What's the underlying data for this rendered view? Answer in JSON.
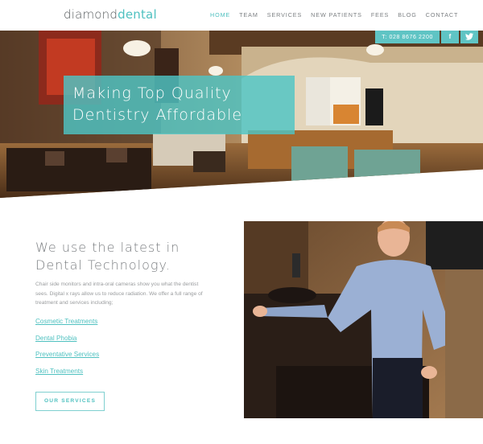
{
  "header": {
    "logo": {
      "part1": "diamond",
      "part2": "dental"
    },
    "nav": [
      {
        "label": "HOME",
        "active": true
      },
      {
        "label": "TEAM",
        "active": false
      },
      {
        "label": "SERVICES",
        "active": false
      },
      {
        "label": "NEW PATIENTS",
        "active": false
      },
      {
        "label": "FEES",
        "active": false
      },
      {
        "label": "BLOG",
        "active": false
      },
      {
        "label": "CONTACT",
        "active": false
      }
    ]
  },
  "hero": {
    "phone": "T: 028 8676 2200",
    "facebook_icon": "f",
    "twitter_icon": "t",
    "title_line1": "Making Top Quality",
    "title_line2": "Dentistry Affordable"
  },
  "main": {
    "headline_line1": "We use the latest in",
    "headline_line2": "Dental Technology.",
    "paragraph": "Chair side monitors and intra-oral cameras show you what the dentist sees. Digital x rays allow us to reduce radiation. We offer a full range of treatment and services including;",
    "links": [
      "Cosmetic Treatments",
      "Dental Phobia",
      "Preventative Services",
      "Skin Treatments"
    ],
    "button": "OUR SERVICES"
  },
  "colors": {
    "accent": "#4fc1c0",
    "text": "#7a7d80"
  }
}
